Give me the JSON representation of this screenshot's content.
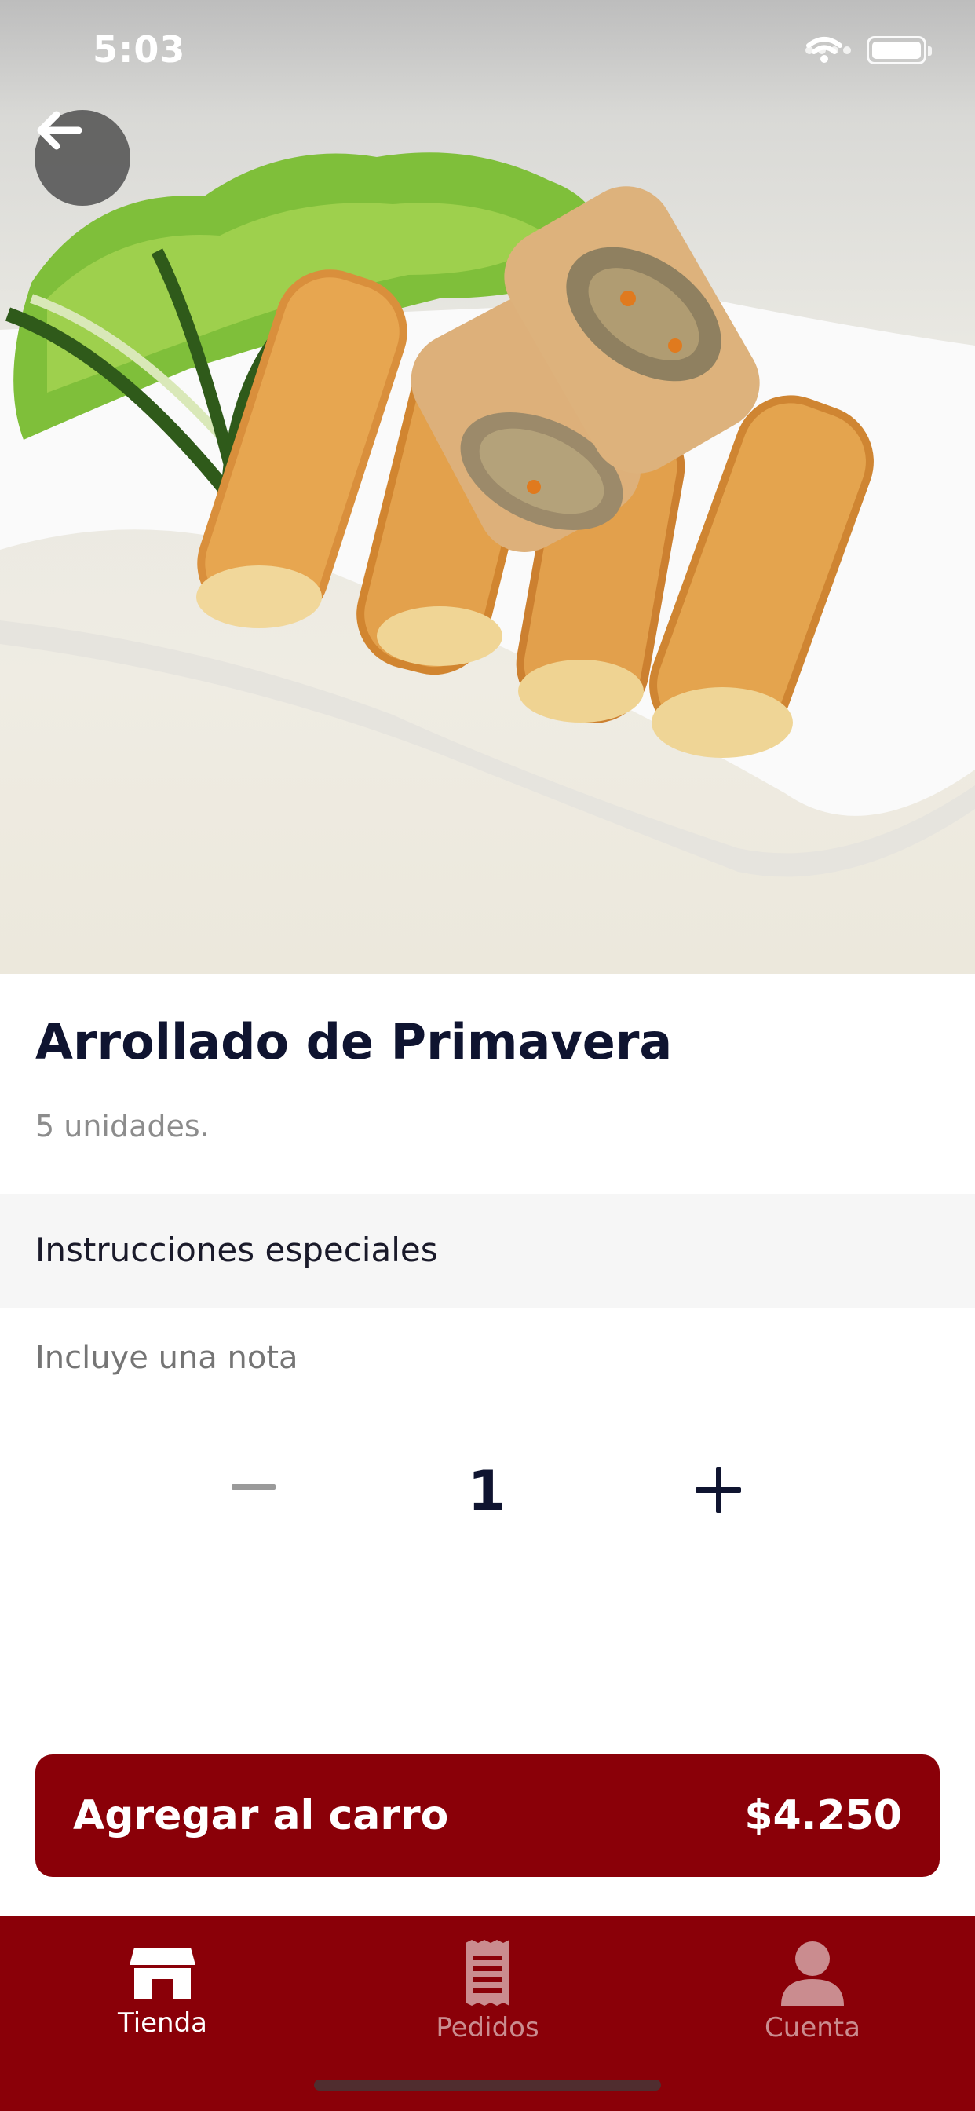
{
  "status_bar": {
    "time": "5:03"
  },
  "product": {
    "image_alt": "Arrollado de Primavera",
    "name": "Arrollado de Primavera",
    "description": "5 unidades."
  },
  "instructions": {
    "title": "Instrucciones especiales",
    "note_placeholder": "Incluye una nota",
    "note_value": ""
  },
  "quantity": {
    "value": "1"
  },
  "cart_button": {
    "label": "Agregar al carro",
    "price": "$4.250"
  },
  "tabbar": {
    "items": [
      {
        "label": "Tienda",
        "icon": "store-icon",
        "active": true
      },
      {
        "label": "Pedidos",
        "icon": "receipt-icon",
        "active": false
      },
      {
        "label": "Cuenta",
        "icon": "user-icon",
        "active": false
      }
    ]
  },
  "colors": {
    "brand": "#8a0008",
    "text_dark": "#0f1430",
    "muted": "#8c8c8c"
  }
}
